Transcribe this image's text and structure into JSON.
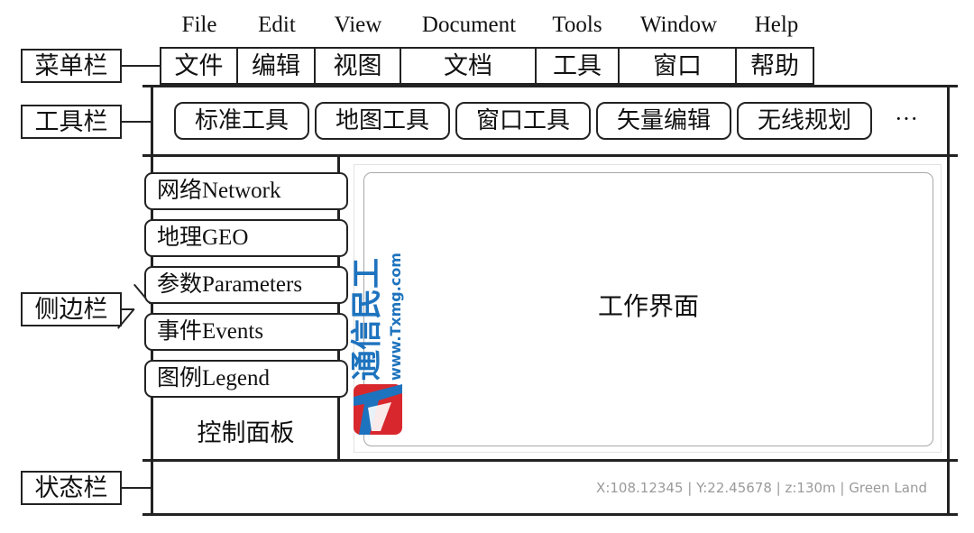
{
  "menu_en": [
    "File",
    "Edit",
    "View",
    "Document",
    "Tools",
    "Window",
    "Help"
  ],
  "menu_cn": [
    "文件",
    "编辑",
    "视图",
    "文档",
    "工具",
    "窗口",
    "帮助"
  ],
  "labels": {
    "menubar": "菜单栏",
    "toolbar": "工具栏",
    "sidebar": "侧边栏",
    "statusbar": "状态栏"
  },
  "toolbar_items": [
    "标准工具",
    "地图工具",
    "窗口工具",
    "矢量编辑",
    "无线规划"
  ],
  "toolbar_more": "···",
  "side_items": [
    "网络Network",
    "地理GEO",
    "参数Parameters",
    "事件Events",
    "图例Legend"
  ],
  "control_panel": "控制面板",
  "workspace": "工作界面",
  "status_text": "X:108.12345 | Y:22.45678 | z:130m | Green Land",
  "watermark": {
    "name": "通信民工",
    "url": "www.Txmg.com",
    "colors": {
      "blue": "#1e73be",
      "red": "#d8282d"
    }
  }
}
